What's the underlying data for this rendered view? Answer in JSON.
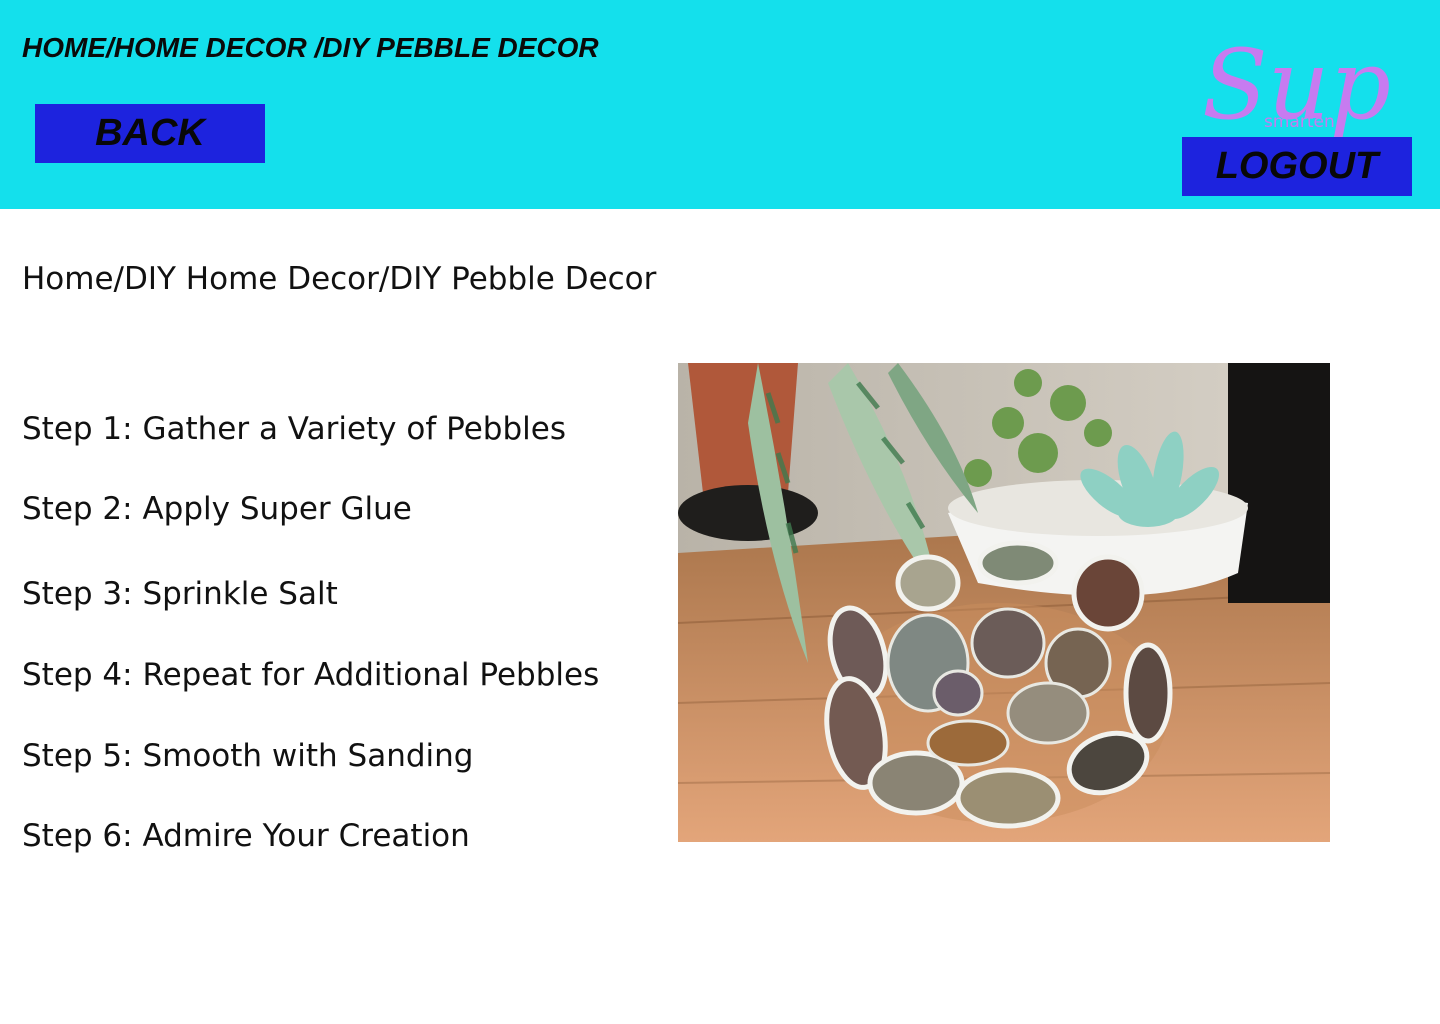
{
  "header": {
    "breadcrumb": "HOME/HOME DECOR /DIY PEBBLE DECOR",
    "back_label": "BACK",
    "logout_label": "LOGOUT",
    "logo": {
      "name": "Sup",
      "tagline": "smarten"
    }
  },
  "main": {
    "breadcrumb": "Home/DIY Home Decor/DIY Pebble Decor",
    "steps": [
      "Step 1: Gather a Variety of Pebbles",
      "Step 2: Apply Super Glue",
      "Step 3: Sprinkle Salt",
      "Step 4: Repeat for Additional Pebbles",
      "Step 5: Smooth with Sanding",
      "Step 6: Admire Your Creation"
    ]
  },
  "colors": {
    "header_bg": "#14e0ec",
    "button_bg": "#1d23de",
    "logo_color": "#c77bf0"
  }
}
